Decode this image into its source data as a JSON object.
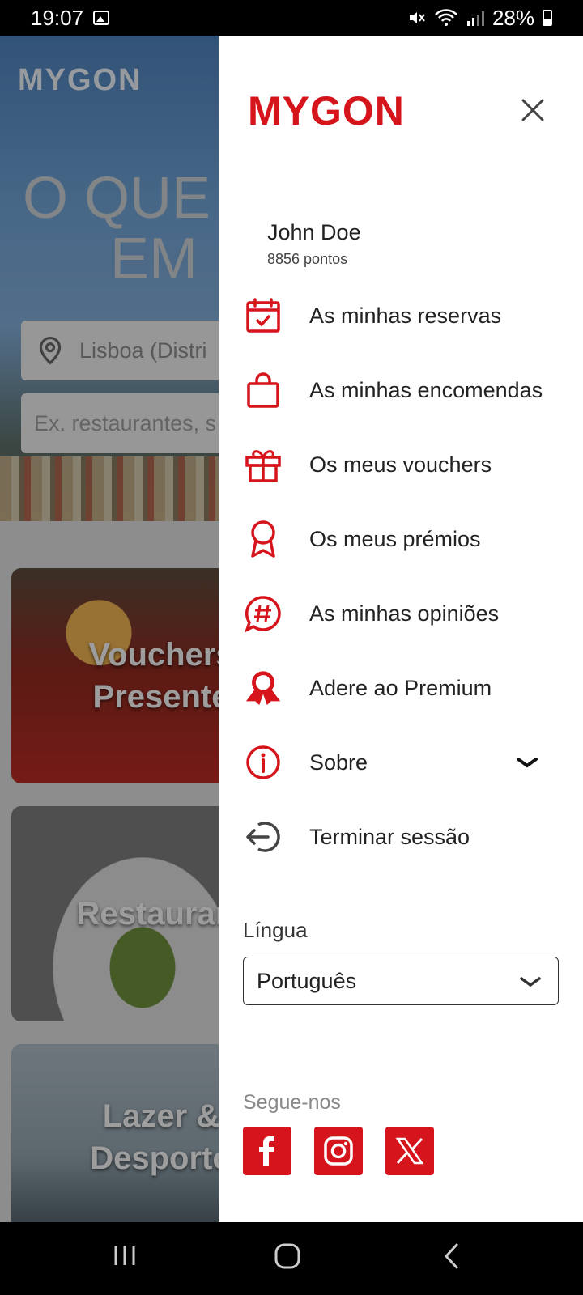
{
  "status": {
    "time": "19:07",
    "battery": "28%"
  },
  "background": {
    "logo": "MYGON",
    "hero_line1": "O QUE",
    "hero_line2": "EM",
    "location_value": "Lisboa (Distri",
    "search_placeholder": "Ex. restaurantes, s",
    "categories": [
      "Vouchers\nPresente",
      "Restaurant",
      "Lazer &\nDesporto"
    ]
  },
  "drawer": {
    "logo": "MYGON",
    "user": {
      "name": "John Doe",
      "points": "8856 pontos"
    },
    "menu": [
      {
        "label": "As minhas reservas",
        "icon": "calendar-check-icon"
      },
      {
        "label": "As minhas encomendas",
        "icon": "shopping-bag-icon"
      },
      {
        "label": "Os meus vouchers",
        "icon": "gift-icon"
      },
      {
        "label": "Os meus prémios",
        "icon": "award-icon"
      },
      {
        "label": "As minhas opiniões",
        "icon": "hashtag-chat-icon"
      },
      {
        "label": "Adere ao Premium",
        "icon": "premium-ribbon-icon"
      },
      {
        "label": "Sobre",
        "icon": "info-icon"
      },
      {
        "label": "Terminar sessão",
        "icon": "logout-icon"
      }
    ],
    "language_label": "Língua",
    "language_value": "Português",
    "follow_label": "Segue-nos",
    "social": [
      "facebook-icon",
      "instagram-icon",
      "x-icon"
    ]
  },
  "colors": {
    "brand": "#d6141c"
  }
}
